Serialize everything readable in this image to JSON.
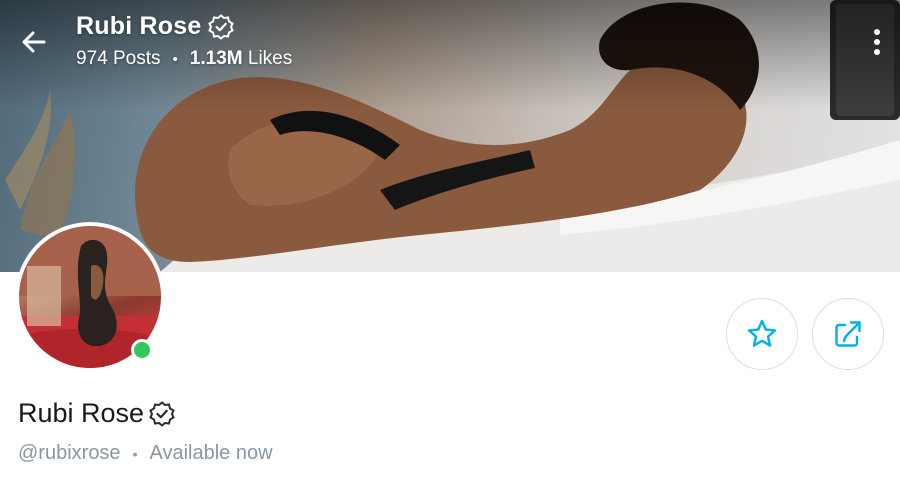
{
  "header": {
    "name": "Rubi Rose",
    "posts_count": "974",
    "posts_label": "Posts",
    "likes_count": "1.13M",
    "likes_label": "Likes",
    "separator": "•"
  },
  "icons": {
    "back": "arrow-left-icon",
    "menu": "more-vertical-icon",
    "verified": "verified-badge-icon",
    "favorite": "star-icon",
    "share": "share-icon"
  },
  "profile": {
    "name": "Rubi Rose",
    "handle": "@rubixrose",
    "separator": "•",
    "status": "Available now",
    "online": true
  },
  "colors": {
    "accent": "#00aff0",
    "online": "#33c75a",
    "muted_text": "#8a96a3",
    "name_text": "#1a1a1a"
  }
}
